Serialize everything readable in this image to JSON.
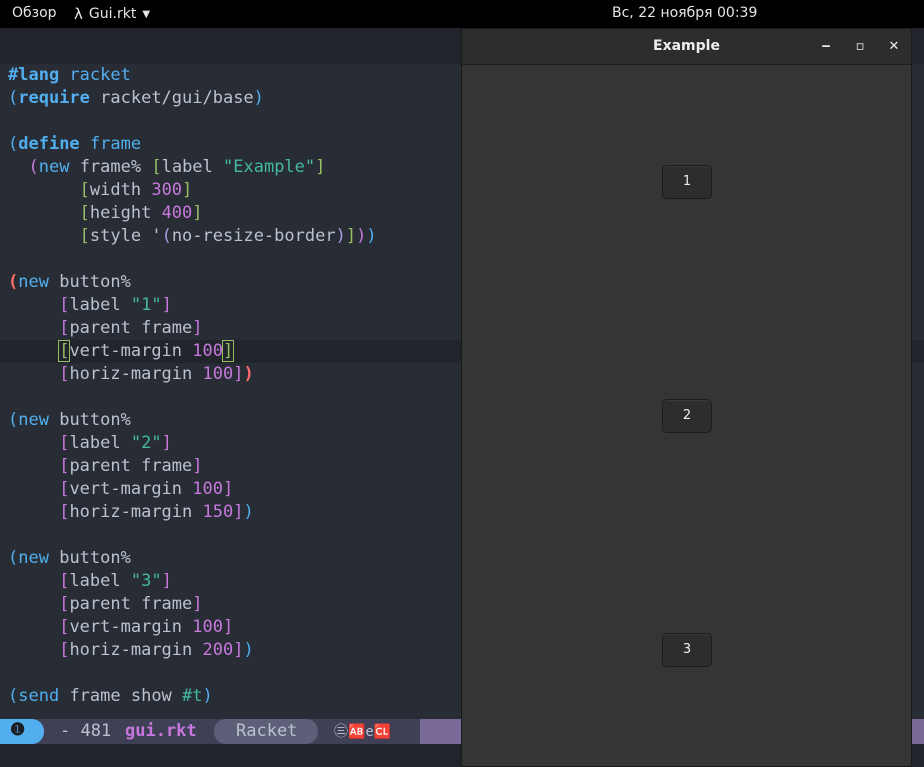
{
  "topbar": {
    "overview": "Обзор",
    "app_name": "Gui.rkt",
    "clock": "Вс, 22 ноября  00:39"
  },
  "editor": {
    "lines": [
      [
        [
          "kwb",
          "#lang"
        ],
        [
          "",
          ""
        ],
        [
          "kw",
          " racket"
        ]
      ],
      [
        [
          "p1",
          "("
        ],
        [
          "kwb",
          "require"
        ],
        [
          "",
          " racket/gui/base"
        ],
        [
          "p1",
          ")"
        ]
      ],
      [
        [
          "",
          ""
        ]
      ],
      [
        [
          "p1",
          "("
        ],
        [
          "kwb",
          "define"
        ],
        [
          "kw",
          " frame"
        ]
      ],
      [
        [
          "",
          "  "
        ],
        [
          "p2",
          "("
        ],
        [
          "kw",
          "new"
        ],
        [
          "",
          " frame% "
        ],
        [
          "p3",
          "["
        ],
        [
          "",
          "label "
        ],
        [
          "str",
          "\"Example\""
        ],
        [
          "p3",
          "]"
        ]
      ],
      [
        [
          "",
          "       "
        ],
        [
          "p3",
          "["
        ],
        [
          "",
          "width "
        ],
        [
          "num",
          "300"
        ],
        [
          "p3",
          "]"
        ]
      ],
      [
        [
          "",
          "       "
        ],
        [
          "p3",
          "["
        ],
        [
          "",
          "height "
        ],
        [
          "num",
          "400"
        ],
        [
          "p3",
          "]"
        ]
      ],
      [
        [
          "",
          "       "
        ],
        [
          "p3",
          "["
        ],
        [
          "",
          "style '"
        ],
        [
          "p4",
          "("
        ],
        [
          "",
          "no-resize-border"
        ],
        [
          "p4",
          ")"
        ],
        [
          "p3",
          "]"
        ],
        [
          "p2",
          ")"
        ],
        [
          "p1",
          ")"
        ]
      ],
      [
        [
          "",
          ""
        ]
      ],
      [
        [
          "red",
          "("
        ],
        [
          "kw",
          "new"
        ],
        [
          "",
          " button%"
        ]
      ],
      [
        [
          "",
          "     "
        ],
        [
          "p2",
          "["
        ],
        [
          "",
          "label "
        ],
        [
          "str",
          "\"1\""
        ],
        [
          "p2",
          "]"
        ]
      ],
      [
        [
          "",
          "     "
        ],
        [
          "p2",
          "["
        ],
        [
          "",
          "parent frame"
        ],
        [
          "p2",
          "]"
        ]
      ],
      [
        [
          "",
          "     "
        ],
        [
          "cursor",
          "["
        ],
        [
          "",
          "vert-margin "
        ],
        [
          "num",
          "100"
        ],
        [
          "cursor",
          "]"
        ]
      ],
      [
        [
          "",
          "     "
        ],
        [
          "p2",
          "["
        ],
        [
          "",
          "horiz-margin "
        ],
        [
          "num",
          "100"
        ],
        [
          "p2",
          "]"
        ],
        [
          "red",
          ")"
        ]
      ],
      [
        [
          "",
          ""
        ]
      ],
      [
        [
          "p1",
          "("
        ],
        [
          "kw",
          "new"
        ],
        [
          "",
          " button%"
        ]
      ],
      [
        [
          "",
          "     "
        ],
        [
          "p2",
          "["
        ],
        [
          "",
          "label "
        ],
        [
          "str",
          "\"2\""
        ],
        [
          "p2",
          "]"
        ]
      ],
      [
        [
          "",
          "     "
        ],
        [
          "p2",
          "["
        ],
        [
          "",
          "parent frame"
        ],
        [
          "p2",
          "]"
        ]
      ],
      [
        [
          "",
          "     "
        ],
        [
          "p2",
          "["
        ],
        [
          "",
          "vert-margin "
        ],
        [
          "num",
          "100"
        ],
        [
          "p2",
          "]"
        ]
      ],
      [
        [
          "",
          "     "
        ],
        [
          "p2",
          "["
        ],
        [
          "",
          "horiz-margin "
        ],
        [
          "num",
          "150"
        ],
        [
          "p2",
          "]"
        ],
        [
          "p1",
          ")"
        ]
      ],
      [
        [
          "",
          ""
        ]
      ],
      [
        [
          "p1",
          "("
        ],
        [
          "kw",
          "new"
        ],
        [
          "",
          " button%"
        ]
      ],
      [
        [
          "",
          "     "
        ],
        [
          "p2",
          "["
        ],
        [
          "",
          "label "
        ],
        [
          "str",
          "\"3\""
        ],
        [
          "p2",
          "]"
        ]
      ],
      [
        [
          "",
          "     "
        ],
        [
          "p2",
          "["
        ],
        [
          "",
          "parent frame"
        ],
        [
          "p2",
          "]"
        ]
      ],
      [
        [
          "",
          "     "
        ],
        [
          "p2",
          "["
        ],
        [
          "",
          "vert-margin "
        ],
        [
          "num",
          "100"
        ],
        [
          "p2",
          "]"
        ]
      ],
      [
        [
          "",
          "     "
        ],
        [
          "p2",
          "["
        ],
        [
          "",
          "horiz-margin "
        ],
        [
          "num",
          "200"
        ],
        [
          "p2",
          "]"
        ],
        [
          "p1",
          ")"
        ]
      ],
      [
        [
          "",
          ""
        ]
      ],
      [
        [
          "p1",
          "("
        ],
        [
          "kw",
          "send"
        ],
        [
          "",
          " frame show "
        ],
        [
          "str",
          "#t"
        ],
        [
          "p1",
          ")"
        ]
      ]
    ],
    "highlight_line": 12
  },
  "modeline": {
    "window_number": "❶",
    "position": "- 481",
    "filename": "gui.rkt",
    "major_mode": "Racket",
    "glyphs": "㊂🆎e🆑"
  },
  "example_window": {
    "title": "Example",
    "minimize": "‒",
    "maximize": "▫",
    "close": "✕",
    "buttons": [
      "1",
      "2",
      "3"
    ]
  },
  "colors": {
    "background": "#282c34",
    "keyword": "#51afef",
    "string": "#44b9a0",
    "number": "#c678dd",
    "modeline_accent": "#51afef"
  }
}
